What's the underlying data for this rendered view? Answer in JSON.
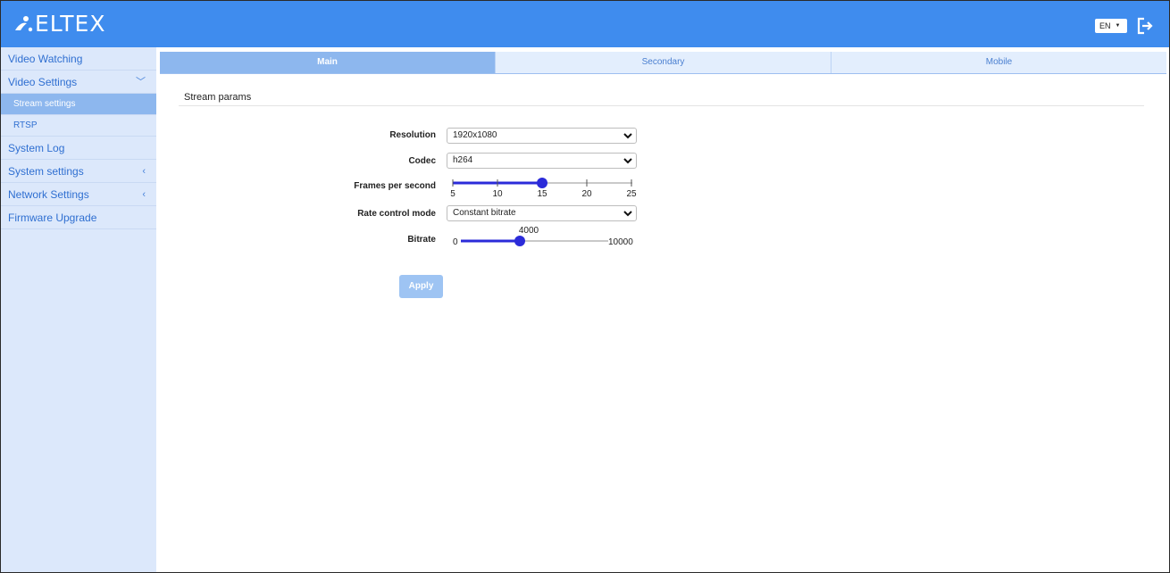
{
  "header": {
    "logo_text": "ELTEX",
    "language": "EN",
    "brand_color": "#3f8cee"
  },
  "sidebar": {
    "items": [
      {
        "label": "Video Watching"
      },
      {
        "label": "Video Settings",
        "expanded": true
      },
      {
        "label": "Stream settings",
        "active": true
      },
      {
        "label": "RTSP"
      },
      {
        "label": "System Log"
      },
      {
        "label": "System settings"
      },
      {
        "label": "Network Settings"
      },
      {
        "label": "Firmware Upgrade"
      }
    ]
  },
  "tabs": [
    {
      "label": "Main",
      "active": true
    },
    {
      "label": "Secondary"
    },
    {
      "label": "Mobile"
    }
  ],
  "section_title": "Stream params",
  "form": {
    "resolution": {
      "label": "Resolution",
      "value": "1920x1080"
    },
    "codec": {
      "label": "Codec",
      "value": "h264"
    },
    "fps": {
      "label": "Frames per second",
      "value": 15,
      "ticks": [
        "5",
        "10",
        "15",
        "20",
        "25"
      ]
    },
    "rate_control": {
      "label": "Rate control mode",
      "value": "Constant bitrate"
    },
    "bitrate": {
      "label": "Bitrate",
      "value": "4000",
      "min": "0",
      "max": "10000"
    }
  },
  "apply_label": "Apply"
}
